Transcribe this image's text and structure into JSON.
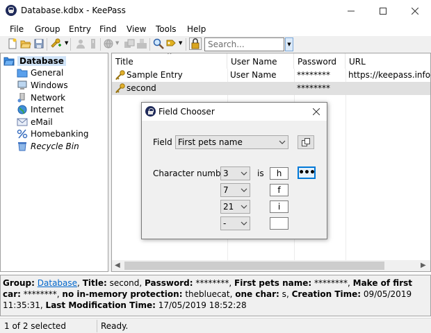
{
  "window": {
    "title": "Database.kdbx - KeePass"
  },
  "menu": [
    "File",
    "Group",
    "Entry",
    "Find",
    "View",
    "Tools",
    "Help"
  ],
  "toolbar": {
    "search_placeholder": "Search..."
  },
  "tree": {
    "root": "Database",
    "items": [
      "General",
      "Windows",
      "Network",
      "Internet",
      "eMail",
      "Homebanking",
      "Recycle Bin"
    ]
  },
  "list": {
    "columns": [
      "Title",
      "User Name",
      "Password",
      "URL"
    ],
    "rows": [
      {
        "title": "Sample Entry",
        "user": "User Name",
        "password": "********",
        "url": "https://keepass.info/"
      },
      {
        "title": "second",
        "user": "",
        "password": "********",
        "url": ""
      }
    ]
  },
  "details": {
    "group_label": "Group:",
    "group_value": "Database",
    "title_label": "Title:",
    "title_value": "second",
    "password_label": "Password:",
    "password_value": "********",
    "pets_label": "First pets name:",
    "pets_value": "********",
    "car_label": "Make of first car:",
    "car_value": "********",
    "nomem_label": "no in-memory protection:",
    "nomem_value": "thebluecat",
    "onechar_label": "one char:",
    "onechar_value": "s",
    "created_label": "Creation Time:",
    "created_value": "09/05/2019 11:35:31",
    "modified_label": "Last Modification Time:",
    "modified_value": "17/05/2019 18:52:28"
  },
  "status": {
    "selection": "1 of 2 selected",
    "state": "Ready."
  },
  "dialog": {
    "title": "Field Chooser",
    "field_label": "Field",
    "field_value": "First pets name",
    "char_label": "Character number",
    "is_label": "is",
    "rows": [
      {
        "number": "3",
        "char": "h"
      },
      {
        "number": "7",
        "char": "f"
      },
      {
        "number": "21",
        "char": "i"
      },
      {
        "number": "-",
        "char": ""
      }
    ],
    "more_label": "•••"
  },
  "colors": {
    "selection": "#cfe3f7",
    "link": "#0066cc",
    "focus": "#0078d7"
  }
}
